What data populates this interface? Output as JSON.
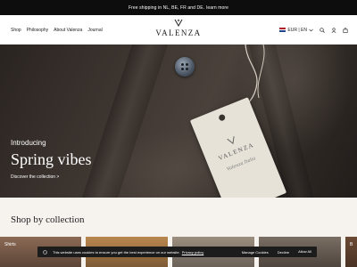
{
  "announcement": {
    "text": "Free shipping in NL, BE, FR and DE.",
    "link": "learn more"
  },
  "header": {
    "nav": [
      "Shop",
      "Philosophy",
      "About Valenza",
      "Journal"
    ],
    "brand": "VALENZA",
    "currency": "EUR | EN",
    "icons": [
      "search-icon",
      "account-icon",
      "cart-icon"
    ]
  },
  "hero": {
    "intro": "Introducing",
    "title": "Spring vibes",
    "cta": "Discover the collection >",
    "tag_brand": "VALENZA",
    "tag_signature": "Valenza Italia"
  },
  "collection": {
    "title": "Shop by collection",
    "cards": [
      {
        "label": "Shirts"
      },
      {
        "label": ""
      },
      {
        "label": ""
      },
      {
        "label": ""
      },
      {
        "label": "B"
      }
    ]
  },
  "cookie": {
    "text": "This website uses cookies to ensure you get the best experience on our website.",
    "policy": "Privacy policy",
    "manage": "Manage Cookies",
    "decline": "Decline",
    "accept": "Allow All"
  },
  "colors": {
    "announce_bg": "#0d0d0d",
    "collection_bg": "#f6f3ef",
    "cookie_bg": "#1c1c1c"
  }
}
